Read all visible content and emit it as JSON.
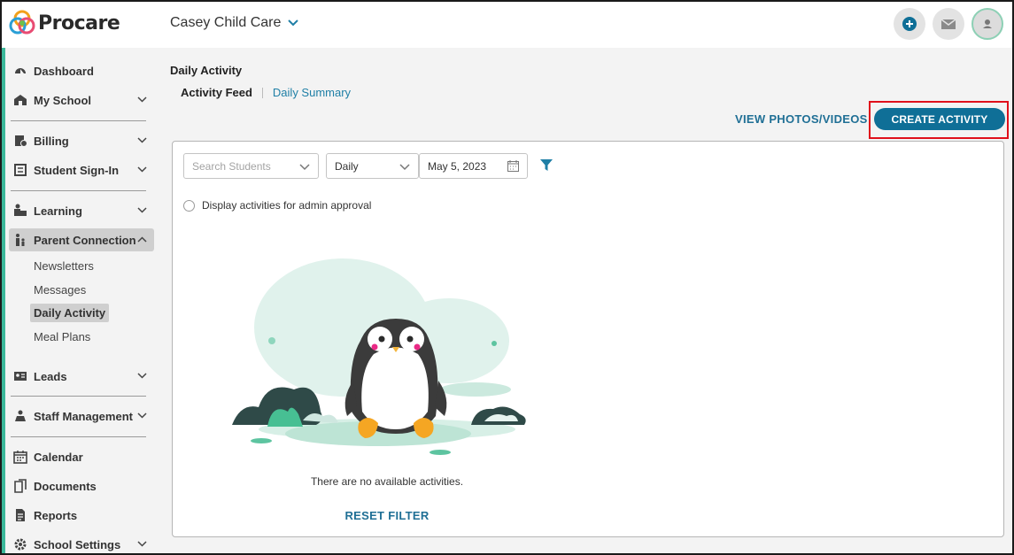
{
  "app": {
    "logo_text": "Procare"
  },
  "header": {
    "school_name": "Casey Child Care",
    "icons": [
      "plus-circle-icon",
      "mail-icon",
      "user-avatar-icon"
    ]
  },
  "sidebar": {
    "items": [
      {
        "label": "Dashboard",
        "icon": "dashboard-icon"
      },
      {
        "label": "My School",
        "icon": "school-icon"
      },
      {
        "label": "Billing",
        "icon": "billing-icon"
      },
      {
        "label": "Student Sign-In",
        "icon": "sign-in-icon"
      },
      {
        "label": "Learning",
        "icon": "learning-icon"
      },
      {
        "label": "Parent Connection",
        "icon": "family-icon"
      },
      {
        "label": "Leads",
        "icon": "leads-icon"
      },
      {
        "label": "Staff Management",
        "icon": "staff-icon"
      },
      {
        "label": "Calendar",
        "icon": "calendar-icon"
      },
      {
        "label": "Documents",
        "icon": "documents-icon"
      },
      {
        "label": "Reports",
        "icon": "reports-icon"
      },
      {
        "label": "School Settings",
        "icon": "gear-icon"
      }
    ],
    "sub_items": [
      "Newsletters",
      "Messages",
      "Daily Activity",
      "Meal Plans"
    ]
  },
  "main": {
    "title": "Daily Activity",
    "tabs": [
      "Activity Feed",
      "Daily Summary"
    ],
    "view_photos_label": "VIEW PHOTOS/VIDEOS",
    "create_label": "CREATE ACTIVITY",
    "search_placeholder": "Search Students",
    "period_value": "Daily",
    "date_value": "May 5, 2023",
    "approval_label": "Display activities for admin approval",
    "empty_message": "There are no available activities.",
    "reset_label": "RESET FILTER"
  },
  "colors": {
    "accent": "#0f6f97",
    "link": "#1f7fa6",
    "highlight": "#e0101b",
    "sidebar_accent": "#3bb89a"
  }
}
